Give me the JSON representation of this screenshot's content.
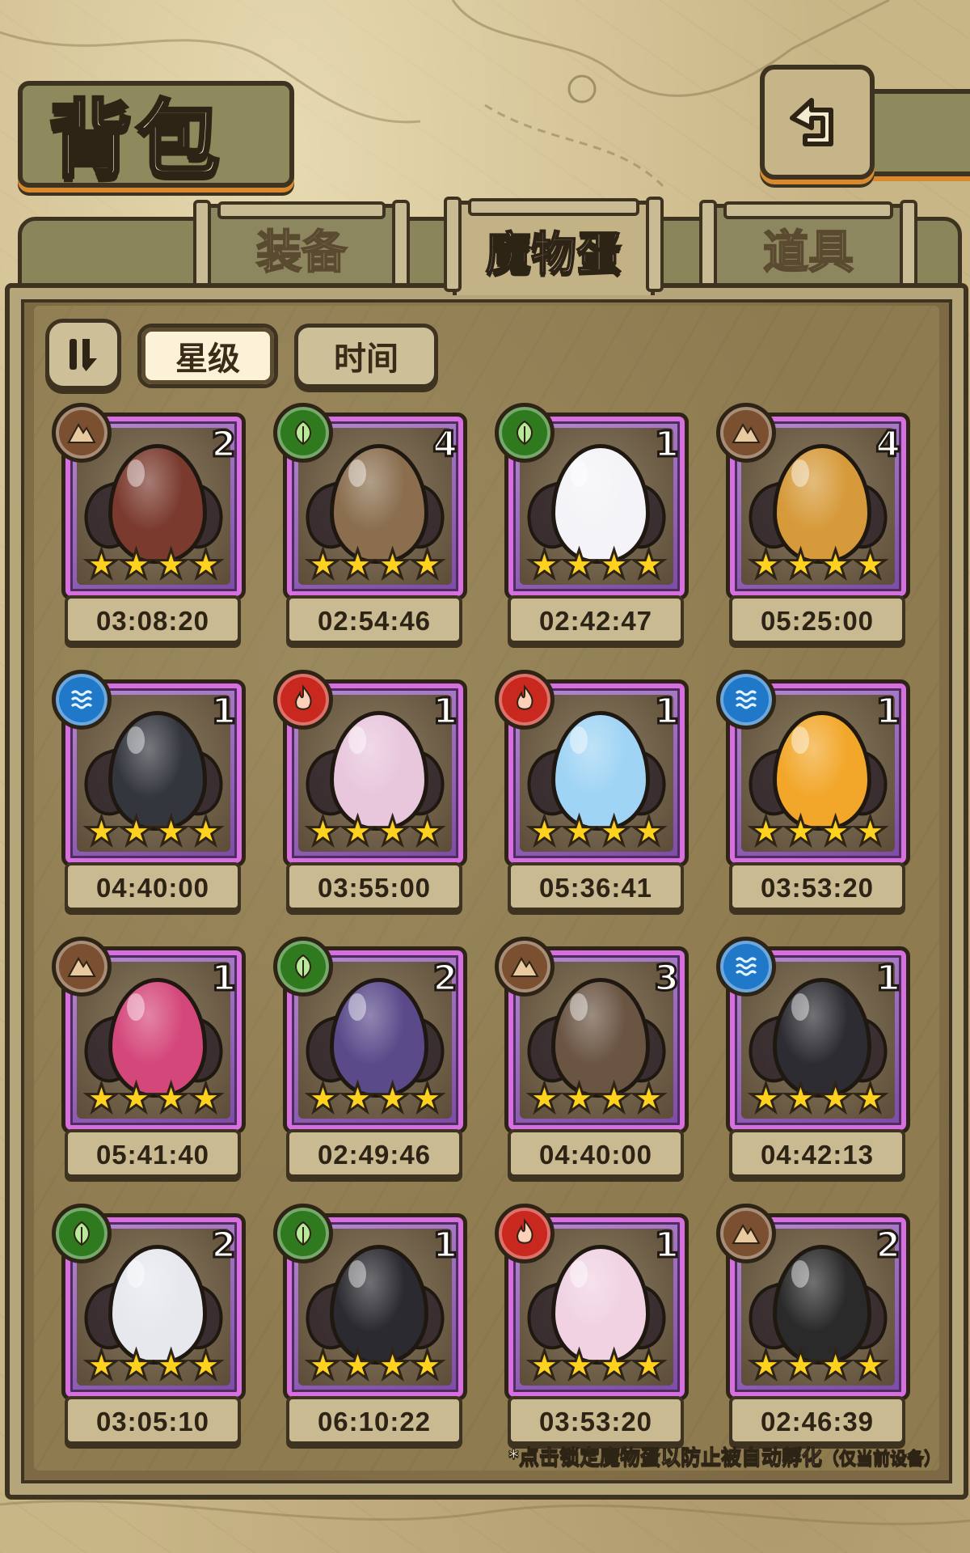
{
  "header": {
    "title": "背包"
  },
  "tabs": [
    {
      "label": "装备",
      "active": false
    },
    {
      "label": "魔物蛋",
      "active": true
    },
    {
      "label": "道具",
      "active": false
    }
  ],
  "sort": {
    "star_label": "星级",
    "time_label": "时间",
    "selected": "星级"
  },
  "element_colors": {
    "earth": "#7a5030",
    "nature": "#2f7a1e",
    "water": "#1f78c8",
    "fire": "#c8281e"
  },
  "eggs": [
    {
      "element": "earth",
      "count": "2",
      "stars": 4,
      "timer": "03:08:20",
      "color": "#7a3a2e"
    },
    {
      "element": "nature",
      "count": "4",
      "stars": 4,
      "timer": "02:54:46",
      "color": "#8a6e4e"
    },
    {
      "element": "nature",
      "count": "1",
      "stars": 4,
      "timer": "02:42:47",
      "color": "#f4f4f8"
    },
    {
      "element": "earth",
      "count": "4",
      "stars": 4,
      "timer": "05:25:00",
      "color": "#d69a3a"
    },
    {
      "element": "water",
      "count": "1",
      "stars": 4,
      "timer": "04:40:00",
      "color": "#34363e"
    },
    {
      "element": "fire",
      "count": "1",
      "stars": 4,
      "timer": "03:55:00",
      "color": "#e8c6dc"
    },
    {
      "element": "fire",
      "count": "1",
      "stars": 4,
      "timer": "05:36:41",
      "color": "#9fd4f4"
    },
    {
      "element": "water",
      "count": "1",
      "stars": 4,
      "timer": "03:53:20",
      "color": "#f2a72a"
    },
    {
      "element": "earth",
      "count": "1",
      "stars": 4,
      "timer": "05:41:40",
      "color": "#d4477a"
    },
    {
      "element": "nature",
      "count": "2",
      "stars": 4,
      "timer": "02:49:46",
      "color": "#5a4a8a"
    },
    {
      "element": "earth",
      "count": "3",
      "stars": 4,
      "timer": "04:40:00",
      "color": "#6a5442"
    },
    {
      "element": "water",
      "count": "1",
      "stars": 4,
      "timer": "04:42:13",
      "color": "#2c2c32"
    },
    {
      "element": "nature",
      "count": "2",
      "stars": 4,
      "timer": "03:05:10",
      "color": "#e6e8ee"
    },
    {
      "element": "nature",
      "count": "1",
      "stars": 4,
      "timer": "06:10:22",
      "color": "#2a2a30"
    },
    {
      "element": "fire",
      "count": "1",
      "stars": 4,
      "timer": "03:53:20",
      "color": "#f0d2e2"
    },
    {
      "element": "earth",
      "count": "2",
      "stars": 4,
      "timer": "02:46:39",
      "color": "#2a2a2a"
    }
  ],
  "footnote": {
    "main": "*点击锁定魔物蛋以防止被自动孵化",
    "note": "（仅当前设备）"
  },
  "icons": {
    "back": "back-arrow-icon",
    "sort_toggle": "sort-direction-icon",
    "star": "star-icon"
  }
}
